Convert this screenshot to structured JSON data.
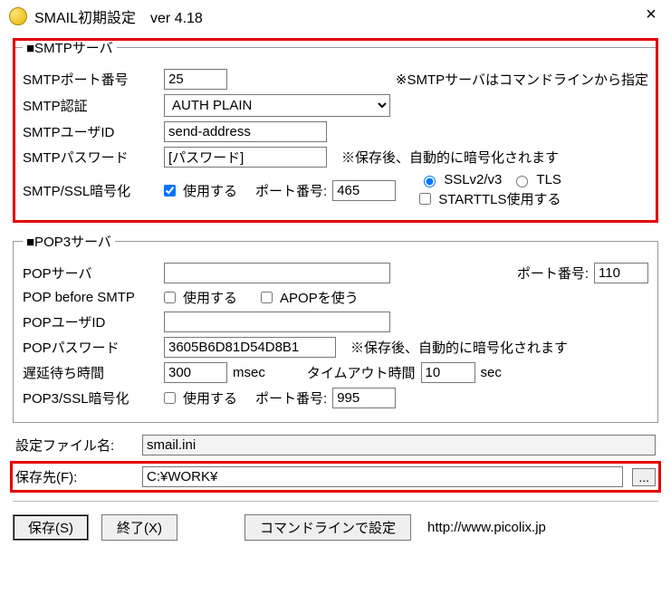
{
  "window": {
    "title": "SMAIL初期設定　ver 4.18",
    "close": "×"
  },
  "smtp": {
    "legend": "■SMTPサーバ",
    "port_label": "SMTPポート番号",
    "port_value": "25",
    "cmdline_note": "※SMTPサーバはコマンドラインから指定",
    "auth_label": "SMTP認証",
    "auth_value": "AUTH PLAIN",
    "user_label": "SMTPユーザID",
    "user_value": "send-address",
    "pass_label": "SMTPパスワード",
    "pass_value": "[パスワード]",
    "pass_note": "※保存後、自動的に暗号化されます",
    "ssl_label": "SMTP/SSL暗号化",
    "ssl_use": "使用する",
    "ssl_port_label": "ポート番号:",
    "ssl_port_value": "465",
    "radio_sslv": "SSLv2/v3",
    "radio_tls": "TLS",
    "chk_starttls": "STARTTLS使用する"
  },
  "pop": {
    "legend": "■POP3サーバ",
    "server_label": "POPサーバ",
    "server_value": "",
    "port_label": "ポート番号:",
    "port_value": "110",
    "pbs_label": "POP before SMTP",
    "pbs_use": "使用する",
    "apop": "APOPを使う",
    "user_label": "POPユーザID",
    "user_value": "",
    "pass_label": "POPパスワード",
    "pass_value": "3605B6D81D54D8B1",
    "pass_note": "※保存後、自動的に暗号化されます",
    "delay_label": "遅延待ち時間",
    "delay_value": "300",
    "delay_unit": "msec",
    "timeout_label": "タイムアウト時間",
    "timeout_value": "10",
    "timeout_unit": "sec",
    "ssl_label": "POP3/SSL暗号化",
    "ssl_use": "使用する",
    "ssl_port_label": "ポート番号:",
    "ssl_port_value": "995"
  },
  "file": {
    "cfg_label": "設定ファイル名:",
    "cfg_value": "smail.ini",
    "dest_label": "保存先(F):",
    "dest_value": "C:¥WORK¥",
    "browse": "..."
  },
  "footer": {
    "save": "保存(S)",
    "exit": "終了(X)",
    "cmdline": "コマンドラインで設定",
    "url": "http://www.picolix.jp"
  }
}
